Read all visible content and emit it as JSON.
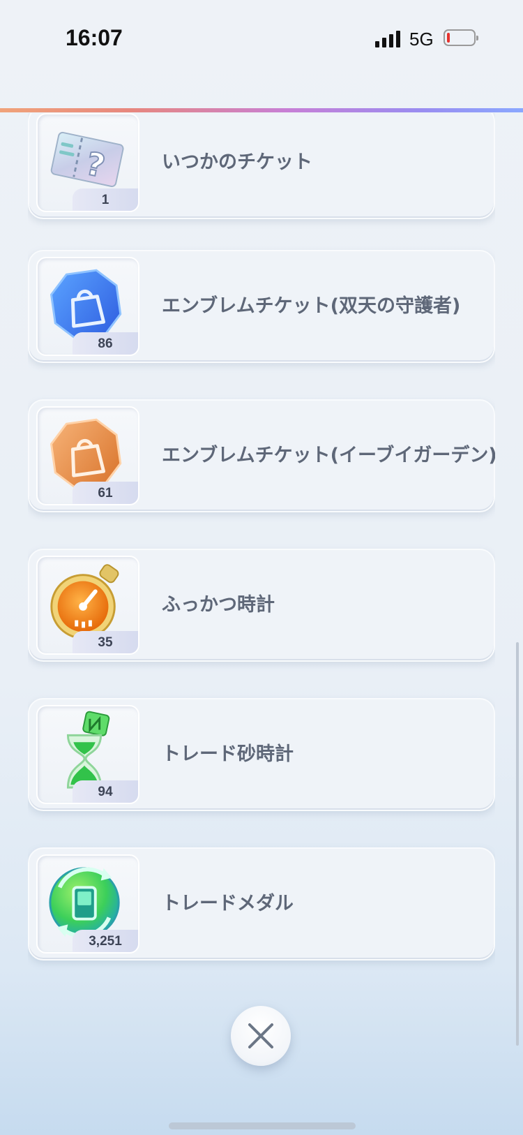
{
  "status_bar": {
    "time": "16:07",
    "network": "5G",
    "battery_color": "#e5322d"
  },
  "items": [
    {
      "name": "いつかのチケット",
      "count": "1",
      "icon": "mystery-ticket-icon"
    },
    {
      "name": "エンブレムチケット(双天の守護者)",
      "count": "86",
      "icon": "blue-emblem-ticket-icon"
    },
    {
      "name": "エンブレムチケット(イーブイガーデン)",
      "count": "61",
      "icon": "orange-emblem-ticket-icon"
    },
    {
      "name": "ふっかつ時計",
      "count": "35",
      "icon": "revival-clock-icon"
    },
    {
      "name": "トレード砂時計",
      "count": "94",
      "icon": "trade-hourglass-icon"
    },
    {
      "name": "トレードメダル",
      "count": "3,251",
      "icon": "trade-medal-icon"
    }
  ],
  "close_icon": "close-icon"
}
